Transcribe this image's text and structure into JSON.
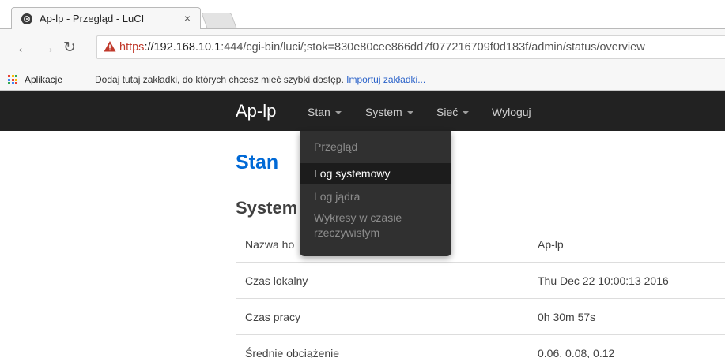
{
  "browser": {
    "tab_title": "Ap-lp - Przegląd - LuCI",
    "tab_close": "×",
    "url_scheme": "https",
    "url_host": "://192.168.10.1",
    "url_rest": ":444/cgi-bin/luci/;stok=830e80cee866dd7f077216709f0d183f/admin/status/overview",
    "bookmarks_apps": "Aplikacje",
    "bookmarks_hint": "Dodaj tutaj zakładki, do których chcesz mieć szybki dostęp.",
    "bookmarks_import": "Importuj zakładki...",
    "icons": {
      "back": "arrow-left-icon",
      "forward": "arrow-right-icon",
      "reload": "reload-icon",
      "warning": "warning-triangle-icon",
      "apps": "apps-grid-icon"
    },
    "warning_color": "#c0392b"
  },
  "navbar": {
    "brand": "Ap-lp",
    "menu": {
      "stan": "Stan",
      "system": "System",
      "siec": "Sieć",
      "logout": "Wyloguj"
    }
  },
  "dropdown": {
    "item_przeglad": "Przegląd",
    "item_log": "Log systemowy",
    "item_log_jadra": "Log jądra",
    "item_wykresy_1": "Wykresy w czasie",
    "item_wykresy_2": "rzeczywistym"
  },
  "page": {
    "title": "Stan",
    "section": "System",
    "accent_color": "#0069d6"
  },
  "status": {
    "hostname_label": "Nazwa ho",
    "hostname_value": "Ap-lp",
    "localtime_label": "Czas lokalny",
    "localtime_value": "Thu Dec 22 10:00:13 2016",
    "uptime_label": "Czas pracy",
    "uptime_value": "0h 30m 57s",
    "load_label": "Średnie obciążenie",
    "load_value": "0.06, 0.08, 0.12"
  }
}
